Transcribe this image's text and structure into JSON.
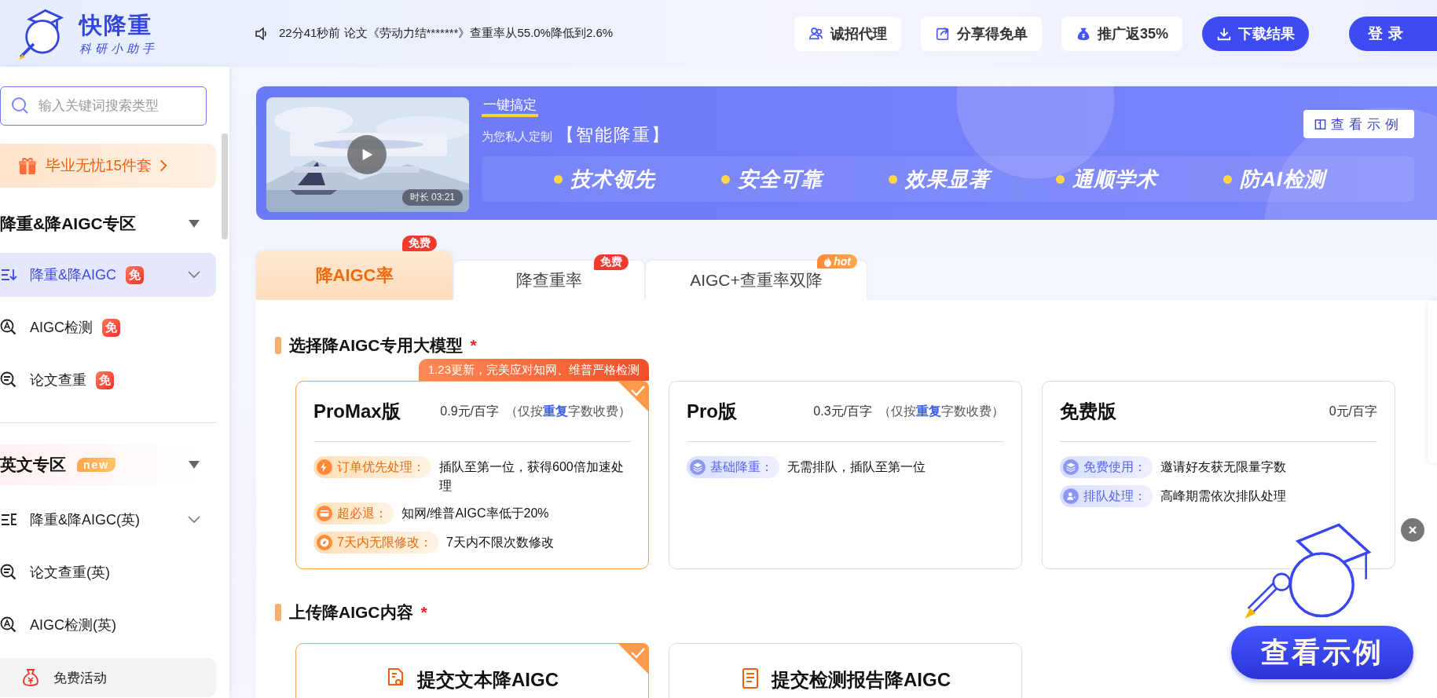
{
  "header": {
    "logo": {
      "title": "快降重",
      "subtitle": "科研小助手"
    },
    "notice": "22分41秒前 论文《劳动力结*******》查重率从55.0%降低到2.6%",
    "buttons": [
      {
        "label": "诚招代理",
        "kind": "recruit"
      },
      {
        "label": "分享得免单",
        "kind": "share"
      },
      {
        "label": "推广返35%",
        "kind": "promote"
      },
      {
        "label": "下载结果",
        "kind": "download"
      }
    ],
    "login": "登录"
  },
  "sidebar": {
    "search": {
      "placeholder": "输入关键词搜索类型"
    },
    "promo": "毕业无忧15件套",
    "sections": [
      {
        "title": "降重&降AIGC专区",
        "expanded": true,
        "highlighted": false,
        "items": [
          {
            "label": "降重&降AIGC",
            "kind": "rewrite",
            "badge": "免",
            "has_submenu": true,
            "selected": true
          },
          {
            "label": "AIGC检测",
            "kind": "detect",
            "badge": "免",
            "has_submenu": false,
            "selected": false
          },
          {
            "label": "论文查重",
            "kind": "check",
            "badge": "免",
            "has_submenu": false,
            "selected": false
          }
        ]
      },
      {
        "title": "英文专区",
        "tag": "new",
        "expanded": true,
        "highlighted": true,
        "items": [
          {
            "label": "降重&降AIGC(英)",
            "kind": "rewrite_en",
            "has_submenu": true,
            "selected": false
          },
          {
            "label": "论文查重(英)",
            "kind": "check",
            "has_submenu": false,
            "selected": false
          },
          {
            "label": "AIGC检测(英)",
            "kind": "detect",
            "has_submenu": false,
            "selected": false
          }
        ]
      }
    ],
    "footer": "免费活动"
  },
  "banner": {
    "video": {
      "duration": "时长 03:21"
    },
    "kicker": "一键搞定",
    "subtitle": "为您私人定制",
    "headline": "【智能降重】",
    "example_button": "查看示例",
    "features": [
      "技术领先",
      "安全可靠",
      "效果显著",
      "通顺学术",
      "防AI检测"
    ]
  },
  "tabs": [
    {
      "label": "降AIGC率",
      "selected": true,
      "badge": {
        "kind": "free",
        "text": "免费"
      }
    },
    {
      "label": "降查重率",
      "selected": false,
      "badge": {
        "kind": "free",
        "text": "免费"
      }
    },
    {
      "label": "AIGC+查重率双降",
      "selected": false,
      "badge": {
        "kind": "hot",
        "text": "hot"
      }
    }
  ],
  "model_section": {
    "title": "选择降AIGC专用大模型",
    "required_mark": "*",
    "plans": [
      {
        "name": "ProMax版",
        "price": "0.9元/百字",
        "note": "（仅按**重复**字数收费）",
        "selected": true,
        "ribbon": "1.23更新，完美应对知网、维普严格检测",
        "features": [
          {
            "kind": "priority",
            "label": "订单优先处理：",
            "text": "插队至第一位，获得600倍加速处理"
          },
          {
            "kind": "refund",
            "label": "超必退：",
            "text": "知网/维普AIGC率低于20%"
          },
          {
            "kind": "revise",
            "label": "7天内无限修改：",
            "text": "7天内不限次数修改"
          }
        ]
      },
      {
        "name": "Pro版",
        "price": "0.3元/百字",
        "note": "（仅按**重复**字数收费）",
        "selected": false,
        "features": [
          {
            "kind": "basic",
            "label": "基础降重：",
            "text": "无需排队，插队至第一位"
          }
        ]
      },
      {
        "name": "免费版",
        "price": "0元/百字",
        "selected": false,
        "features": [
          {
            "kind": "free",
            "label": "免费使用：",
            "text": "邀请好友获无限量字数"
          },
          {
            "kind": "queue",
            "label": "排队处理：",
            "text": "高峰期需依次排队处理"
          }
        ]
      }
    ]
  },
  "upload_section": {
    "title": "上传降AIGC内容",
    "required_mark": "*",
    "options": [
      {
        "label": "提交文本降AIGC",
        "kind": "text",
        "selected": true
      },
      {
        "label": "提交检测报告降AIGC",
        "kind": "report",
        "selected": false
      }
    ]
  },
  "float_promo": {
    "button": "查看示例"
  }
}
